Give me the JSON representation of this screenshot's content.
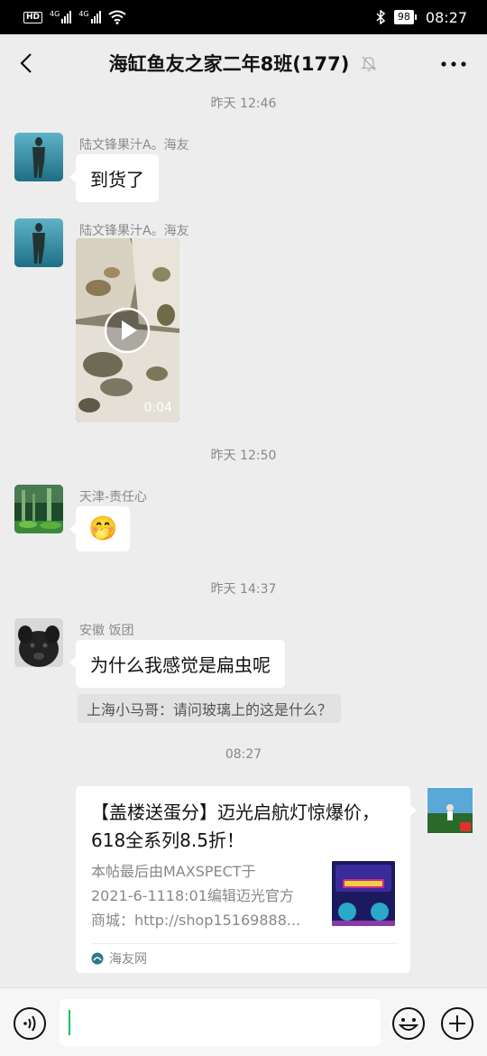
{
  "status_bar": {
    "hd_label": "HD",
    "net1": "4G",
    "net2": "4G",
    "battery": "98",
    "time": "08:27"
  },
  "header": {
    "title": "海缸鱼友之家二年8班(177)"
  },
  "timestamps": [
    "昨天 12:46",
    "昨天 12:50",
    "昨天 14:37",
    "08:27"
  ],
  "messages": [
    {
      "sender": "陆文锋果汁A。海友",
      "text": "到货了"
    },
    {
      "sender": "陆文锋果汁A。海友",
      "video_duration": "0:04"
    },
    {
      "sender": "天津-责任心",
      "emoji": "🤭"
    },
    {
      "sender": "安徽 饭团",
      "text": "为什么我感觉是扁虫呢",
      "quote": "上海小马哥：请问玻璃上的这是什么？"
    }
  ],
  "card": {
    "title": "【盖楼送蛋分】迈光启航灯惊爆价，618全系列8.5折！",
    "desc_lines": [
      "本帖最后由MAXSPECT于",
      "2021-6-1118:01编辑迈光官方",
      "商城：http://shop15169888..."
    ],
    "source": "海友网"
  },
  "colors": {
    "cursor": "#07c160",
    "background": "#ededed"
  }
}
